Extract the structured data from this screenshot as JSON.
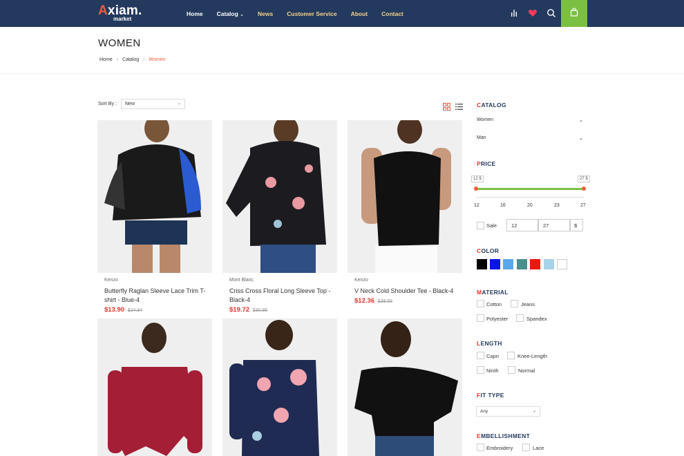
{
  "header": {
    "logo_main": "xiam.",
    "logo_a": "A",
    "logo_sub": "market",
    "nav": [
      "Home",
      "Catalog",
      "News",
      "Customer Service",
      "About",
      "Contact"
    ],
    "catalog_chevron": "⌄"
  },
  "page": {
    "title": "WOMEN",
    "breadcrumb": [
      "Home",
      "Catalog",
      "Women"
    ],
    "breadcrumb_sep": "›"
  },
  "sort": {
    "label": "Sort By :",
    "value": "New",
    "chevron": "⌄"
  },
  "products": [
    {
      "brand": "Kenzo",
      "name": "Butterfly Raglan Sleeve Lace Trim T-shirt - Blue-4",
      "price": "$13.90",
      "old_price": "$24.84"
    },
    {
      "brand": "Mont Blanc",
      "name": "Criss Cross Floral Long Sleeve Top - Black-4",
      "price": "$19.72",
      "old_price": "$30.95"
    },
    {
      "brand": "Kenzo",
      "name": "V Neck Cold Shoulder Tee - Black-4",
      "price": "$12.36",
      "old_price": "$38.55"
    },
    {
      "brand": "",
      "name": "",
      "price": "",
      "old_price": ""
    },
    {
      "brand": "",
      "name": "",
      "price": "",
      "old_price": ""
    },
    {
      "brand": "",
      "name": "",
      "price": "",
      "old_price": ""
    }
  ],
  "sidebar": {
    "catalog": {
      "title_first": "C",
      "title_rest": "ATALOG",
      "items": [
        "Women",
        "Man"
      ]
    },
    "price": {
      "title_first": "P",
      "title_rest": "RICE",
      "min_tag": "12 $",
      "max_tag": "27 $",
      "ticks": [
        "12",
        "16",
        "20",
        "23",
        "27"
      ],
      "sale_label": "Sale",
      "min_value": "12",
      "max_value": "27",
      "currency": "$",
      "range_min": 12,
      "range_max": 27
    },
    "color": {
      "title_first": "C",
      "title_rest": "OLOR",
      "swatches": [
        "#000000",
        "#0a14e6",
        "#5aa7ec",
        "#4b8f8c",
        "#e8190e",
        "#a7d2e8",
        "#ffffff"
      ]
    },
    "material": {
      "title_first": "M",
      "title_rest": "ATERIAL",
      "options": [
        "Cotton",
        "Jeans",
        "Polyester",
        "Spandex"
      ]
    },
    "length": {
      "title_first": "L",
      "title_rest": "ENGTH",
      "options": [
        "Capri",
        "Knee-Length",
        "Ninth",
        "Normal"
      ]
    },
    "fit_type": {
      "title_first": "F",
      "title_rest": "IT TYPE",
      "value": "Any",
      "chevron": "⌄"
    },
    "embellishment": {
      "title_first": "E",
      "title_rest": "MBELLISHMENT",
      "options": [
        "Embroidery",
        "Lace"
      ]
    }
  },
  "colors": {
    "header_bg": "#233a5e",
    "accent_green": "#7bc043",
    "accent_red": "#e5352b"
  },
  "icons": [
    "bar-chart-icon",
    "heart-icon",
    "search-icon",
    "cart-icon",
    "grid-view-icon",
    "list-view-icon"
  ]
}
